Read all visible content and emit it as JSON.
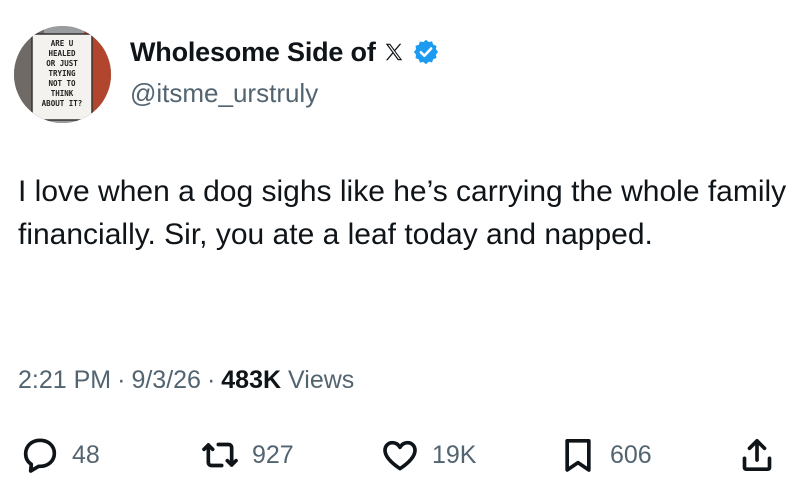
{
  "author": {
    "display_name": "Wholesome Side of",
    "handle": "@itsme_urstruly",
    "avatar_sign_text": "ARE U HEALED OR JUST TRYING NOT TO THINK ABOUT IT?"
  },
  "tweet": {
    "text": "I love when a dog sighs like he’s carrying the whole family financially. Sir, you ate a leaf today and napped.",
    "time": "2:21 PM",
    "date": "9/3/26",
    "views_count": "483K",
    "views_label": "Views"
  },
  "actions": {
    "replies": "48",
    "reposts": "927",
    "likes": "19K",
    "bookmarks": "606"
  },
  "colors": {
    "verified_blue": "#1d9bf0",
    "text_primary": "#0f1419",
    "text_secondary": "#536471"
  },
  "icons": [
    "x-logo-icon",
    "verified-badge-icon",
    "reply-icon",
    "repost-icon",
    "like-icon",
    "bookmark-icon",
    "share-icon"
  ]
}
